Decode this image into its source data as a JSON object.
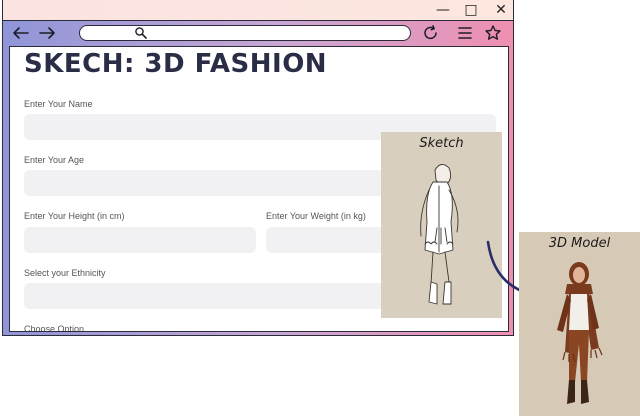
{
  "window": {
    "controls": {
      "minimize": "—",
      "maximize": "□",
      "close": "✕"
    }
  },
  "toolbar": {
    "back_icon": "arrow-left-icon",
    "forward_icon": "arrow-right-icon",
    "address_value": "",
    "reload_icon": "reload-icon",
    "menu_icon": "menu-icon",
    "bookmark_icon": "star-icon"
  },
  "page": {
    "title": "SKECH: 3D FASHION",
    "form": {
      "name_label": "Enter Your Name",
      "name_value": "",
      "age_label": "Enter Your Age",
      "age_value": "",
      "height_label": "Enter Your Height (in cm)",
      "height_value": "",
      "weight_label": "Enter Your Weight (in kg)",
      "weight_value": "",
      "ethnicity_label": "Select your Ethnicity",
      "ethnicity_value": "",
      "option_label": "Choose Option"
    }
  },
  "illustration": {
    "sketch_caption": "Sketch",
    "model_caption": "3D Model"
  }
}
